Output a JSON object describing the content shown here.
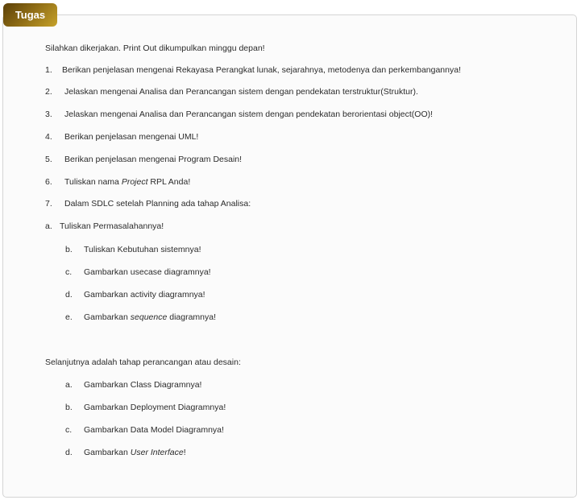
{
  "badge": {
    "label": "Tugas"
  },
  "intro": "Silahkan dikerjakan. Print Out dikumpulkan minggu depan!",
  "items": [
    {
      "num": "1.",
      "text": "Berikan penjelasan mengenai Rekayasa Perangkat lunak, sejarahnya, metodenya dan perkembangannya!"
    },
    {
      "num": "2.",
      "text": "Jelaskan mengenai Analisa dan Perancangan sistem dengan pendekatan terstruktur(Struktur)."
    },
    {
      "num": "3.",
      "text": "Jelaskan mengenai Analisa dan Perancangan sistem dengan pendekatan berorientasi object(OO)!"
    },
    {
      "num": "4.",
      "text": "Berikan penjelasan mengenai UML!"
    },
    {
      "num": "5.",
      "text": "Berikan penjelasan mengenai Program Desain!"
    },
    {
      "num": "6.",
      "text_pre": "Tuliskan nama ",
      "text_italic": "Project",
      "text_post": " RPL Anda!"
    },
    {
      "num": "7.",
      "text": "Dalam SDLC setelah Planning ada tahap Analisa:"
    }
  ],
  "analysis": [
    {
      "num": "a.",
      "text": "Tuliskan Permasalahannya!"
    },
    {
      "num": "b.",
      "text": "Tuliskan Kebutuhan sistemnya!"
    },
    {
      "num": "c.",
      "text": "Gambarkan usecase diagramnya!"
    },
    {
      "num": "d.",
      "text": "Gambarkan activity diagramnya!"
    },
    {
      "num": "e.",
      "text_pre": "Gambarkan ",
      "text_italic": "sequence",
      "text_post": " diagramnya!"
    }
  ],
  "design_intro": "Selanjutnya adalah tahap perancangan atau desain:",
  "design": [
    {
      "num": "a.",
      "text": "Gambarkan Class Diagramnya!"
    },
    {
      "num": "b.",
      "text": "Gambarkan Deployment Diagramnya!"
    },
    {
      "num": "c.",
      "text": "Gambarkan Data Model Diagramnya!"
    },
    {
      "num": "d.",
      "text_pre": "Gambarkan ",
      "text_italic": "User Interface",
      "text_post": "!"
    }
  ]
}
